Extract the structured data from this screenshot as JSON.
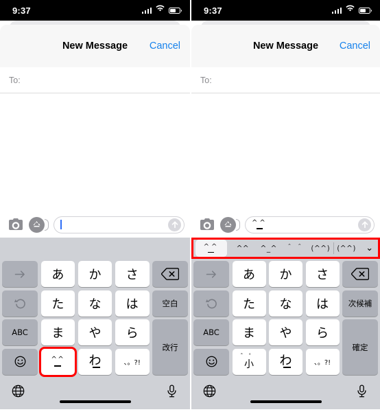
{
  "panels": [
    {
      "id": "left",
      "status": {
        "time": "9:37",
        "signal_icon": "cellular-signal-icon",
        "wifi_icon": "wifi-icon",
        "battery_icon": "battery-icon"
      },
      "nav": {
        "title": "New Message",
        "cancel_label": "Cancel"
      },
      "to": {
        "label": "To:",
        "value": ""
      },
      "compose": {
        "camera_icon": "camera-icon",
        "appstore_icon": "app-store-icon",
        "input_value": "",
        "input_has_caret": true,
        "send_icon": "send-arrow-up-icon"
      },
      "suggestions": {
        "visible": false,
        "items": [],
        "highlighted": false
      },
      "keyboard": {
        "rows": [
          [
            {
              "label": "→",
              "type": "fn",
              "name": "key-arrow-right"
            },
            {
              "label": "あ",
              "type": "char",
              "name": "key-a"
            },
            {
              "label": "か",
              "type": "char",
              "name": "key-ka"
            },
            {
              "label": "さ",
              "type": "char",
              "name": "key-sa"
            },
            {
              "label": "⌫",
              "type": "fn",
              "name": "key-backspace"
            }
          ],
          [
            {
              "label": "↺",
              "type": "fn",
              "name": "key-undo"
            },
            {
              "label": "た",
              "type": "char",
              "name": "key-ta"
            },
            {
              "label": "な",
              "type": "char",
              "name": "key-na"
            },
            {
              "label": "は",
              "type": "char",
              "name": "key-ha"
            },
            {
              "label": "空白",
              "type": "fn",
              "name": "key-space"
            }
          ],
          [
            {
              "label": "ABC",
              "type": "fn",
              "name": "key-abc"
            },
            {
              "label": "ま",
              "type": "char",
              "name": "key-ma"
            },
            {
              "label": "や",
              "type": "char",
              "name": "key-ya"
            },
            {
              "label": "ら",
              "type": "char",
              "name": "key-ra"
            },
            {
              "label": "改行",
              "type": "fn",
              "name": "key-newline"
            }
          ],
          [
            {
              "label": "☺",
              "type": "fn",
              "name": "key-emoji"
            },
            {
              "label": "^^",
              "type": "kaomoji",
              "name": "key-kaomoji",
              "highlighted": true
            },
            {
              "label": "わ",
              "type": "wa",
              "name": "key-wa"
            },
            {
              "label": "、。?!",
              "type": "punct",
              "name": "key-punctuation"
            }
          ]
        ],
        "bottom": {
          "globe_icon": "globe-icon",
          "mic_icon": "microphone-icon"
        }
      }
    },
    {
      "id": "right",
      "status": {
        "time": "9:37",
        "signal_icon": "cellular-signal-icon",
        "wifi_icon": "wifi-icon",
        "battery_icon": "battery-icon"
      },
      "nav": {
        "title": "New Message",
        "cancel_label": "Cancel"
      },
      "to": {
        "label": "To:",
        "value": ""
      },
      "compose": {
        "camera_icon": "camera-icon",
        "appstore_icon": "app-store-icon",
        "input_value": "^_^",
        "input_has_caret": false,
        "send_icon": "send-arrow-up-icon"
      },
      "suggestions": {
        "visible": true,
        "highlighted": true,
        "items": [
          {
            "label": "^_^",
            "kind": "face",
            "selected": true,
            "name": "suggestion-kaomoji-1"
          },
          {
            "label": "^^",
            "kind": "text",
            "selected": false,
            "name": "suggestion-kaomoji-2"
          },
          {
            "label": "^_^",
            "kind": "text",
            "selected": false,
            "name": "suggestion-kaomoji-3"
          },
          {
            "label": "＾ ＾",
            "kind": "text",
            "selected": false,
            "name": "suggestion-kaomoji-4"
          },
          {
            "label": "(^^)",
            "kind": "text",
            "selected": false,
            "name": "suggestion-kaomoji-5"
          },
          {
            "label": "(^^)",
            "kind": "text",
            "selected": false,
            "name": "suggestion-kaomoji-6"
          }
        ],
        "expand_icon": "chevron-down-icon"
      },
      "keyboard": {
        "rows": [
          [
            {
              "label": "→",
              "type": "fn",
              "name": "key-arrow-right"
            },
            {
              "label": "あ",
              "type": "char",
              "name": "key-a"
            },
            {
              "label": "か",
              "type": "char",
              "name": "key-ka"
            },
            {
              "label": "さ",
              "type": "char",
              "name": "key-sa"
            },
            {
              "label": "⌫",
              "type": "fn",
              "name": "key-backspace"
            }
          ],
          [
            {
              "label": "↺",
              "type": "fn",
              "name": "key-undo"
            },
            {
              "label": "た",
              "type": "char",
              "name": "key-ta"
            },
            {
              "label": "な",
              "type": "char",
              "name": "key-na"
            },
            {
              "label": "は",
              "type": "char",
              "name": "key-ha"
            },
            {
              "label": "次候補",
              "type": "fn",
              "name": "key-next-candidate"
            }
          ],
          [
            {
              "label": "ABC",
              "type": "fn",
              "name": "key-abc"
            },
            {
              "label": "ま",
              "type": "char",
              "name": "key-ma"
            },
            {
              "label": "や",
              "type": "char",
              "name": "key-ya"
            },
            {
              "label": "ら",
              "type": "char",
              "name": "key-ra"
            },
            {
              "label": "確定",
              "type": "fn",
              "name": "key-confirm"
            }
          ],
          [
            {
              "label": "☺",
              "type": "fn",
              "name": "key-emoji"
            },
            {
              "label": "小",
              "type": "kogaki",
              "marks": "゛゜",
              "name": "key-small-dakuten"
            },
            {
              "label": "わ",
              "type": "wa",
              "name": "key-wa"
            },
            {
              "label": "、。?!",
              "type": "punct",
              "name": "key-punctuation"
            }
          ]
        ],
        "bottom": {
          "globe_icon": "globe-icon",
          "mic_icon": "microphone-icon"
        }
      }
    }
  ],
  "colors": {
    "accent_blue": "#1782ec",
    "highlight_red": "#ff0000",
    "keyboard_bg": "#cfd1d6",
    "key_white": "#ffffff",
    "key_grey": "#adb0b8"
  }
}
